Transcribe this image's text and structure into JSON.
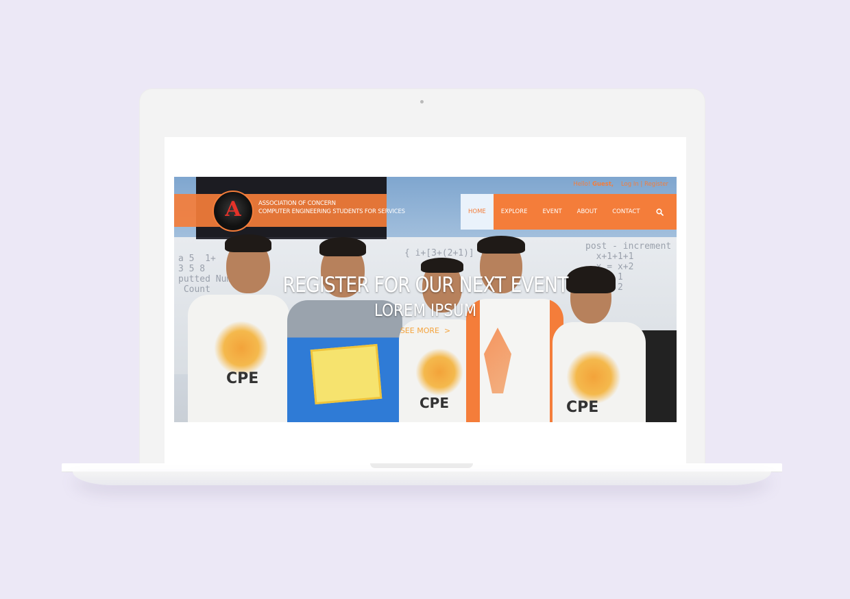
{
  "site": {
    "org_name_line1": "ASSOCIATION OF CONCERN",
    "org_name_line2": "COMPUTER ENGINEERING STUDENTS FOR SERVICES",
    "logo_letter": "A"
  },
  "topbar": {
    "greeting": "Hello!",
    "user": "Guest,",
    "login": "Log In",
    "separator": "|",
    "register": "Register"
  },
  "nav": {
    "items": [
      {
        "label": "HOME",
        "active": true
      },
      {
        "label": "EXPLORE",
        "active": false
      },
      {
        "label": "EVENT",
        "active": false
      },
      {
        "label": "ABOUT",
        "active": false
      },
      {
        "label": "CONTACT",
        "active": false
      }
    ],
    "search_icon": "search-icon"
  },
  "hero": {
    "headline": "REGISTER FOR OUR NEXT EVENT",
    "subline": "LOREM IPSUM",
    "cta": "SEE MORE",
    "cta_arrow": ">"
  },
  "colors": {
    "accent": "#f47d3a",
    "background": "#ece8f6",
    "cta": "#f4a33c"
  }
}
